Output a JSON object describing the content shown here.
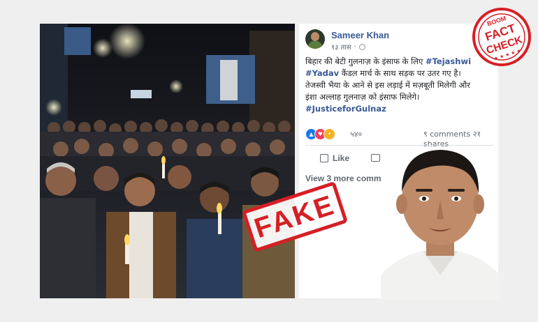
{
  "post": {
    "author": "Sameer Khan",
    "time": "१३ तास",
    "lines": [
      [
        {
          "t": "बिहार की बेटी गुलनाज़ के इंसाफ के लिए ",
          "tag": false
        },
        {
          "t": "#Tejashwi",
          "tag": true
        }
      ],
      [
        {
          "t": "#Yadav",
          "tag": true
        },
        {
          "t": " कैंडल मार्च के साथ सड़क पर उतर गए है।",
          "tag": false
        }
      ],
      [
        {
          "t": "तेजस्वी भैया के आने से इस लड़ाई में मज़बूती मिलेगी और",
          "tag": false
        }
      ],
      [
        {
          "t": "इंशा अल्लाह गुलनाज़ को इंसाफ मिलेगे।",
          "tag": false
        }
      ],
      [
        {
          "t": "#JusticeforGulnaz",
          "tag": true
        }
      ]
    ],
    "reaction_count": "५४०",
    "comments_shares": "९ comments  २१ shares",
    "like_label": "Like",
    "view_more": "View 3 more comm"
  },
  "stamps": {
    "fact_check_top": "BOOM",
    "fact_check_line1": "FACT",
    "fact_check_line2": "CHECK",
    "fake": "FAKE"
  },
  "icons": {
    "reactions": [
      "like-reaction-icon",
      "love-reaction-icon",
      "sad-reaction-icon"
    ],
    "privacy": "globe-icon"
  },
  "colors": {
    "link": "#385898",
    "stamp_red": "#d51f25",
    "background": "#efefef"
  }
}
